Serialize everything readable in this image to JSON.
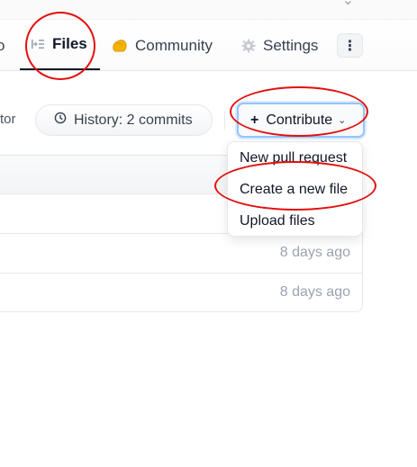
{
  "tabs": {
    "files_label": "Files",
    "community_label": "Community",
    "settings_label": "Settings",
    "more_label": "⋮"
  },
  "toolbar": {
    "contributor_partial": "tor",
    "history_label": "History: 2 commits",
    "contribute_label": "Contribute"
  },
  "contribute_menu": {
    "items": [
      {
        "label": "New pull request"
      },
      {
        "label": "Create a new file"
      },
      {
        "label": "Upload files"
      }
    ]
  },
  "file_rows": [
    {
      "time": ""
    },
    {
      "time": "8 days ago"
    },
    {
      "time": "8 days ago"
    }
  ],
  "colors": {
    "annotation": "#e3100f",
    "focus_ring": "#93c5fd",
    "community_icon": "#f5b301"
  },
  "icons": {
    "files_tab": "file-tree-icon",
    "community_tab": "community-icon",
    "settings_tab": "gear-icon",
    "more": "kebab-icon",
    "history": "clock-icon",
    "contribute_plus": "plus-icon",
    "contribute_chevron": "chevron-down-icon"
  }
}
